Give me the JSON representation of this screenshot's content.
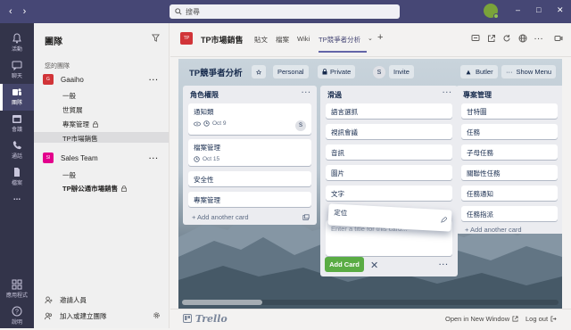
{
  "topbar": {
    "search_placeholder": "搜尋",
    "win_min": "–",
    "win_max": "□",
    "win_close": "✕"
  },
  "rail": {
    "items": [
      {
        "label": "活動"
      },
      {
        "label": "聊天"
      },
      {
        "label": "團隊"
      },
      {
        "label": "會議"
      },
      {
        "label": "通話"
      },
      {
        "label": "檔案"
      },
      {
        "label": "..."
      }
    ],
    "bottom": [
      {
        "label": "應用程式"
      },
      {
        "label": "說明"
      }
    ]
  },
  "panel": {
    "title": "團隊",
    "section_label": "您的團隊",
    "teams": [
      {
        "logo": "G",
        "name": "Gaaiho",
        "color": "#d13438",
        "channels": [
          "一般",
          "世貿展",
          "專案管理",
          "TP市場銷售"
        ]
      },
      {
        "logo": "SI",
        "name": "Sales Team",
        "color": "#e3008c",
        "channels": [
          "一般",
          "TP辦公通市場銷售"
        ]
      }
    ],
    "invite_label": "邀請人員",
    "join_label": "加入或建立團隊"
  },
  "channel": {
    "logo": "TP",
    "name": "TP市場銷售",
    "tabs": [
      "貼文",
      "檔案",
      "Wiki",
      "TP競爭者分析"
    ]
  },
  "board": {
    "title": "TP競爭者分析",
    "visibility_personal": "Personal",
    "visibility_private": "Private",
    "member_initial": "S",
    "invite_label": "Invite",
    "butler_label": "Butler",
    "menu_label": "Show Menu",
    "lists": [
      {
        "title": "角色權限",
        "cards": [
          {
            "text": "通知類",
            "due": "Oct 9",
            "member": "S"
          },
          {
            "text": "檔案管理",
            "due": "Oct 15"
          },
          {
            "text": "安全性"
          },
          {
            "text": "專案管理"
          }
        ],
        "add_label": "+ Add another card"
      },
      {
        "title": "滑過",
        "cards": [
          {
            "text": "語言選抓"
          },
          {
            "text": "視訊會議"
          },
          {
            "text": "音訊"
          },
          {
            "text": "圖片"
          },
          {
            "text": "文字"
          }
        ],
        "compose_placeholder": "Enter a title for this card...",
        "dragging_card": "定位",
        "add_card_button": "Add Card"
      },
      {
        "title": "專案管理",
        "cards": [
          {
            "text": "甘特圖"
          },
          {
            "text": "任務"
          },
          {
            "text": "子母任務"
          },
          {
            "text": "關聯性任務"
          },
          {
            "text": "任務通知"
          },
          {
            "text": "任務指派"
          }
        ],
        "add_label": "+ Add another card"
      }
    ]
  },
  "footer": {
    "brand": "Trello",
    "open_new": "Open in New Window",
    "logout": "Log out"
  }
}
